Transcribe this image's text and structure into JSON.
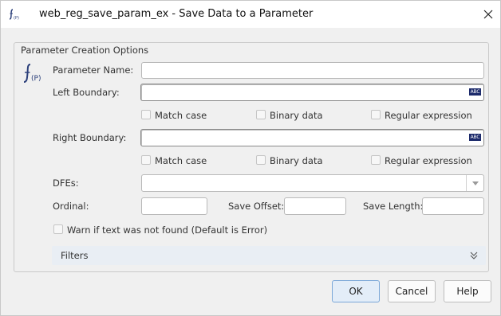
{
  "window": {
    "title": "web_reg_save_param_ex - Save Data to a Parameter"
  },
  "group": {
    "legend": "Parameter Creation Options"
  },
  "fields": {
    "parameter_name_label": "Parameter Name:",
    "parameter_name_value": "",
    "left_boundary_label": "Left Boundary:",
    "left_boundary_value": "",
    "right_boundary_label": "Right Boundary:",
    "right_boundary_value": "",
    "dfes_label": "DFEs:",
    "dfes_value": "",
    "ordinal_label": "Ordinal:",
    "ordinal_value": "",
    "save_offset_label": "Save Offset:",
    "save_offset_value": "",
    "save_length_label": "Save Length:",
    "save_length_value": "",
    "abc_badge": "ABC"
  },
  "left_options": {
    "match_case": "Match case",
    "binary_data": "Binary data",
    "regular_expression": "Regular expression"
  },
  "right_options": {
    "match_case": "Match case",
    "binary_data": "Binary data",
    "regular_expression": "Regular expression"
  },
  "warn": {
    "label": "Warn if text was not found (Default is Error)",
    "checked": false
  },
  "filters": {
    "label": "Filters"
  },
  "buttons": {
    "ok": "OK",
    "cancel": "Cancel",
    "help": "Help"
  },
  "icons": {
    "title_icon": "function-parameter-icon",
    "big_icon": "function-parameter-icon",
    "close": "close-icon",
    "abc": "spell-check-icon",
    "combo": "chevron-down-icon",
    "filters": "double-chevron-down-icon"
  },
  "colors": {
    "abc_badge": "#1c2a6b",
    "ok_button_bg": "#e3edf8",
    "ok_button_border": "#7aa7d8",
    "filters_bar": "#e9eef4"
  }
}
